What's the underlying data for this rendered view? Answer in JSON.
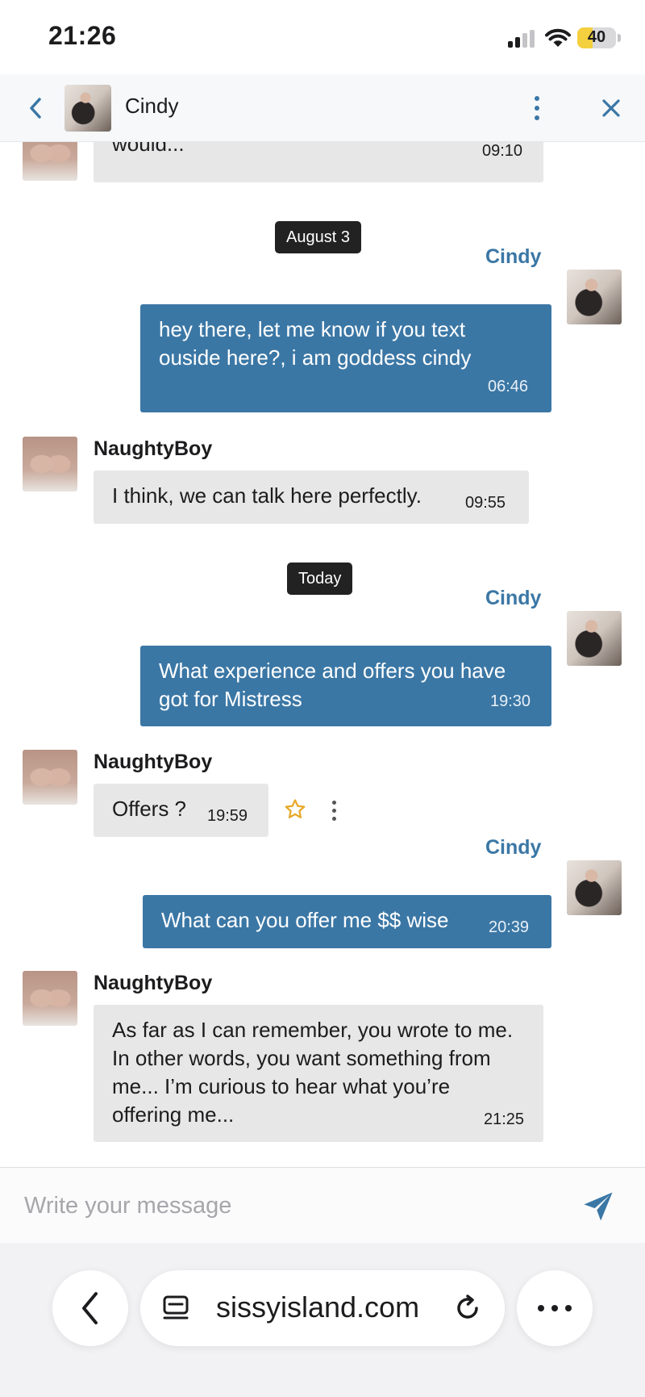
{
  "status_bar": {
    "time": "21:26",
    "battery": "40",
    "battery_level": 0.4
  },
  "chat_header": {
    "contact_name": "Cindy"
  },
  "messages": [
    {
      "from": "NaughtyBoy",
      "text": "would...",
      "time": "09:10"
    },
    {
      "date_divider": "August 3"
    },
    {
      "sender": "Cindy",
      "text": "hey there, let me know if you text ouside here?, i am goddess cindy",
      "time": "06:46"
    },
    {
      "sender": "NaughtyBoy",
      "text": "I think, we can talk here perfectly.",
      "time": "09:55"
    },
    {
      "date_divider": "Today"
    },
    {
      "sender": "Cindy",
      "text": "What experience and offers you have got for Mistress",
      "time": "19:30"
    },
    {
      "sender": "NaughtyBoy",
      "text": "Offers ?",
      "time": "19:59"
    },
    {
      "sender": "Cindy",
      "text": "What can you offer me $$ wise",
      "time": "20:39"
    },
    {
      "sender": "NaughtyBoy",
      "text": "As far as I can remember, you wrote to me. In other words, you want something from me... I’m curious to hear what you’re offering me...",
      "time": "21:25"
    }
  ],
  "composer": {
    "placeholder": "Write your message"
  },
  "browser": {
    "url": "sissyisland.com"
  },
  "colors": {
    "accent": "#3b77a5",
    "incoming_bubble": "#e7e7e7",
    "date_pill": "#222222",
    "star": "#e7a92b"
  }
}
